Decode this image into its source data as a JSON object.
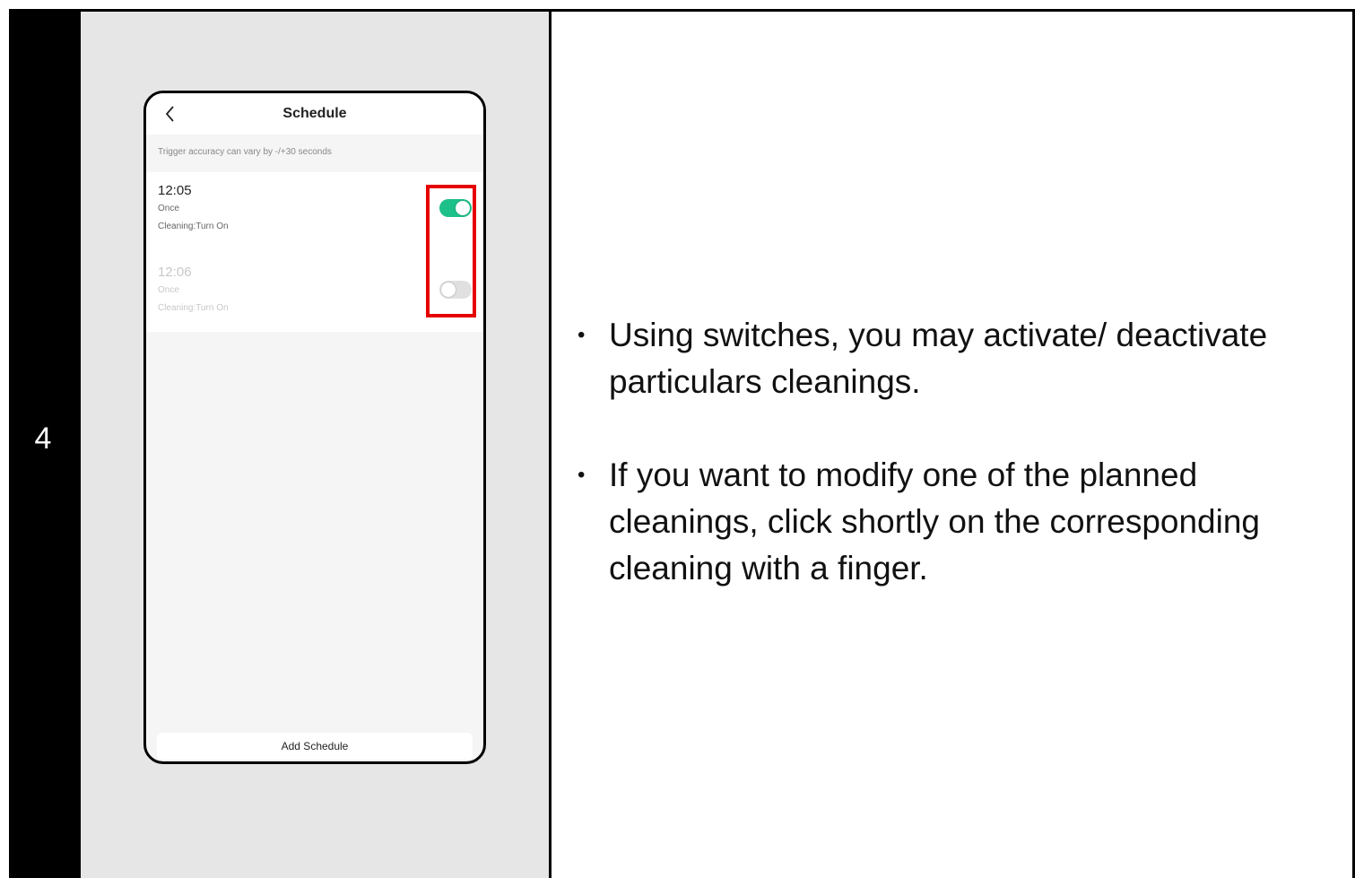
{
  "step": {
    "number": "4"
  },
  "phone": {
    "title": "Schedule",
    "hint": "Trigger accuracy can vary by -/+30 seconds",
    "schedules": [
      {
        "time": "12:05",
        "repeat": "Once",
        "action": "Cleaning:Turn On",
        "enabled": true
      },
      {
        "time": "12:06",
        "repeat": "Once",
        "action": "Cleaning:Turn On",
        "enabled": false
      }
    ],
    "add_button": "Add Schedule",
    "colors": {
      "toggle_on": "#1ec08a",
      "highlight": "#e60000"
    }
  },
  "instructions": [
    "Using switches, you may activate/ deactivate particulars cleanings.",
    "If you want to modify one of the planned cleanings, click shortly on the corresponding cleaning with a finger."
  ]
}
